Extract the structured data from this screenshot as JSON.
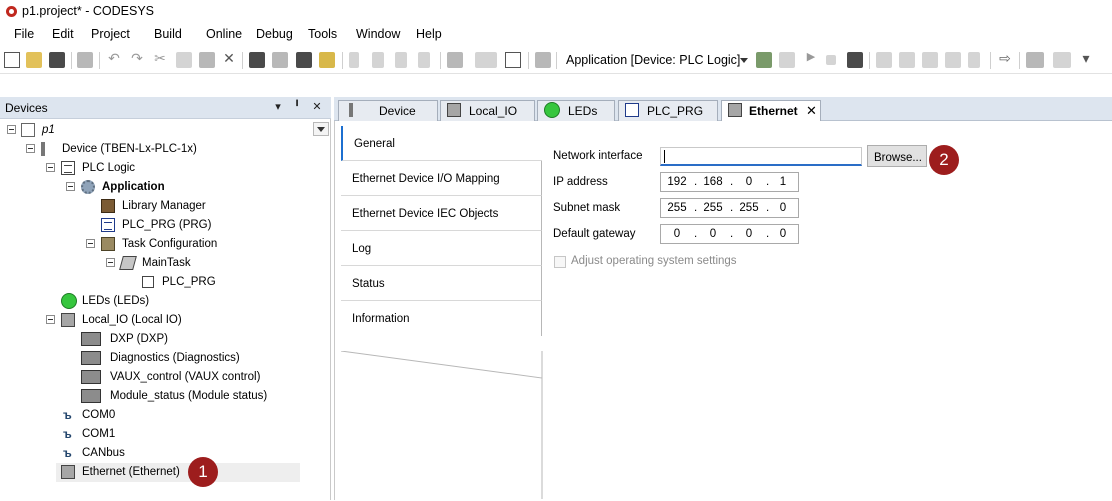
{
  "window": {
    "title": "p1.project* - CODESYS"
  },
  "menu": [
    "File",
    "Edit",
    "Project",
    "Build",
    "Online",
    "Debug",
    "Tools",
    "Window",
    "Help"
  ],
  "toolbar": {
    "application_combo": "Application [Device: PLC Logic]"
  },
  "devices_panel": {
    "title": "Devices",
    "pin_glyph": "▾",
    "dock_glyph": "╹",
    "close_glyph": "✕",
    "tree": [
      {
        "label": "p1"
      },
      {
        "label": "Device (TBEN-Lx-PLC-1x)"
      },
      {
        "label": "PLC Logic"
      },
      {
        "label": "Application"
      },
      {
        "label": "Library Manager"
      },
      {
        "label": "PLC_PRG (PRG)"
      },
      {
        "label": "Task Configuration"
      },
      {
        "label": "MainTask"
      },
      {
        "label": "PLC_PRG"
      },
      {
        "label": "LEDs (LEDs)"
      },
      {
        "label": "Local_IO (Local IO)"
      },
      {
        "label": "DXP (DXP)"
      },
      {
        "label": "Diagnostics (Diagnostics)"
      },
      {
        "label": "VAUX_control (VAUX control)"
      },
      {
        "label": "Module_status (Module status)"
      },
      {
        "label": "COM0"
      },
      {
        "label": "COM1"
      },
      {
        "label": "CANbus"
      },
      {
        "label": "Ethernet (Ethernet)"
      }
    ]
  },
  "editor_tabs": [
    {
      "label": "Device"
    },
    {
      "label": "Local_IO"
    },
    {
      "label": "LEDs"
    },
    {
      "label": "PLC_PRG"
    },
    {
      "label": "Ethernet",
      "close": "✕"
    }
  ],
  "side_tabs": [
    "General",
    "Ethernet Device I/O Mapping",
    "Ethernet Device IEC Objects",
    "Log",
    "Status",
    "Information"
  ],
  "general": {
    "network_interface_label": "Network interface",
    "network_interface_value": "",
    "browse_label": "Browse...",
    "ip_label": "IP address",
    "ip": [
      "192",
      "168",
      "0",
      "1"
    ],
    "subnet_label": "Subnet mask",
    "subnet": [
      "255",
      "255",
      "255",
      "0"
    ],
    "gateway_label": "Default gateway",
    "gateway": [
      "0",
      "0",
      "0",
      "0"
    ],
    "ip_sep": ".",
    "adjust_label": "Adjust operating system settings"
  },
  "callouts": [
    "1",
    "2"
  ],
  "colors": {
    "callout": "#9d1d1d",
    "panel_header": "#dde5ef",
    "focus": "#2a6dc7",
    "led": "#36c63e"
  }
}
